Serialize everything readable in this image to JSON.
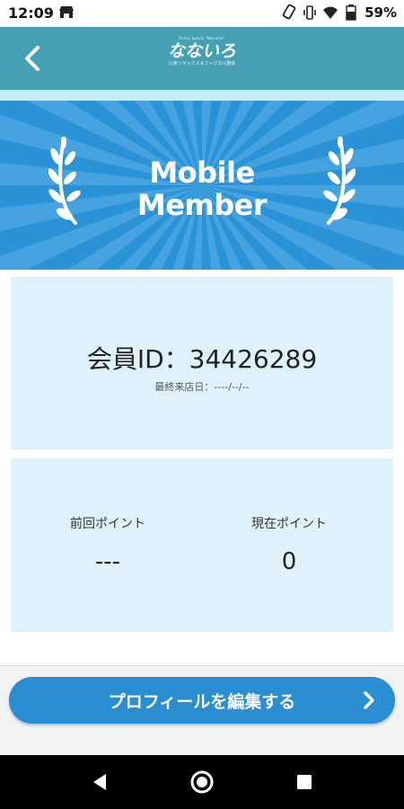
{
  "status_bar": {
    "time": "12:09",
    "battery_percent": "59%",
    "icons": [
      "store-icon",
      "phone-rotate-icon",
      "vibrate-icon",
      "wifi-icon",
      "battery-icon"
    ]
  },
  "header": {
    "back_icon": "chevron-left-icon",
    "logo": {
      "top_text": "Relax Space \"Nanairo\"",
      "main_text": "なないろ",
      "sub_text": "心身リラックス＆フィジカル整体"
    }
  },
  "banner": {
    "title_line1": "Mobile",
    "title_line2": "Member",
    "colors": {
      "background": "#2a93d8",
      "rays": "#5fb1e6"
    }
  },
  "member_card": {
    "member_id_label": "会員ID：",
    "member_id_value": "34426289",
    "last_visit_label": "最終来店日：",
    "last_visit_value": "----/--/--"
  },
  "points_card": {
    "previous_label": "前回ポイント",
    "previous_value": "---",
    "current_label": "現在ポイント",
    "current_value": "0"
  },
  "actions": {
    "edit_profile_label": "プロフィールを編集する"
  },
  "colors": {
    "header": "#46a0b4",
    "header_underline": "#c4eef6",
    "card_bg": "#dff2fb",
    "button": "#2a8ed3"
  }
}
